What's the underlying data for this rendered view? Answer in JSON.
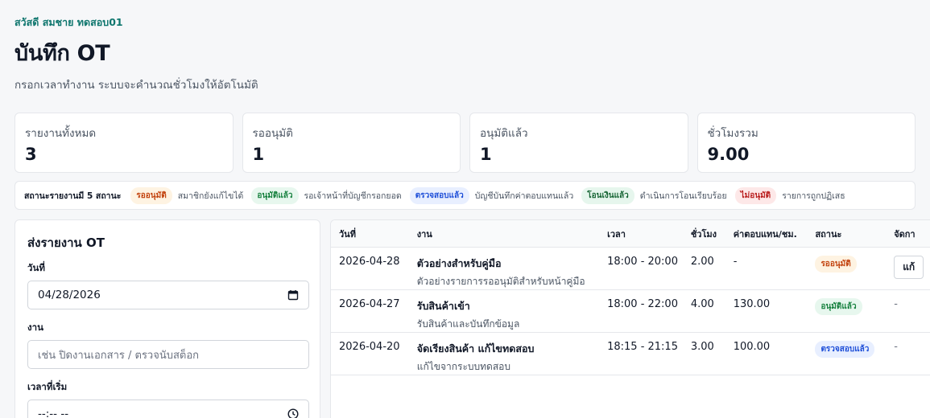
{
  "header": {
    "greeting": "สวัสดี สมชาย ทดสอบ01",
    "title": "บันทึก OT",
    "subtitle": "กรอกเวลาทำงาน ระบบจะคำนวณชั่วโมงให้อัตโนมัติ"
  },
  "stats": [
    {
      "label": "รายงานทั้งหมด",
      "value": "3"
    },
    {
      "label": "รออนุมัติ",
      "value": "1"
    },
    {
      "label": "อนุมัติแล้ว",
      "value": "1"
    },
    {
      "label": "ชั่วโมงรวม",
      "value": "9.00"
    }
  ],
  "legend": {
    "title": "สถานะรายงานมี 5 สถานะ",
    "items": [
      {
        "badge": "รออนุมัติ",
        "desc": "สมาชิกยังแก้ไขได้"
      },
      {
        "badge": "อนุมัติแล้ว",
        "desc": "รอเจ้าหน้าที่บัญชีกรอกยอด"
      },
      {
        "badge": "ตรวจสอบแล้ว",
        "desc": "บัญชีบันทึกค่าตอบแทนแล้ว"
      },
      {
        "badge": "โอนเงินแล้ว",
        "desc": "ดำเนินการโอนเรียบร้อย"
      },
      {
        "badge": "ไม่อนุมัติ",
        "desc": "รายการถูกปฏิเสธ"
      }
    ]
  },
  "form": {
    "title": "ส่งรายงาน OT",
    "date_label": "วันที่",
    "date_value": "04/28/2026",
    "task_label": "งาน",
    "task_placeholder": "เช่น ปิดงานเอกสาร / ตรวจนับสต็อก",
    "start_label": "เวลาที่เริ่ม",
    "start_value": "--:-- --"
  },
  "table": {
    "columns": [
      "วันที่",
      "งาน",
      "เวลา",
      "ชั่วโมง",
      "ค่าตอบแทน/ชม.",
      "สถานะ",
      "จัดกา"
    ],
    "rows": [
      {
        "date": "2026-04-28",
        "task": "ตัวอย่างสำหรับคู่มือ",
        "desc": "ตัวอย่างรายการรออนุมัติสำหรับหน้าคู่มือ",
        "time": "18:00 - 20:00",
        "hours": "2.00",
        "rate": "-",
        "status": "รออนุมัติ",
        "action": "แก้"
      },
      {
        "date": "2026-04-27",
        "task": "รับสินค้าเข้า",
        "desc": "รับสินค้าและบันทึกข้อมูล",
        "time": "18:00 - 22:00",
        "hours": "4.00",
        "rate": "130.00",
        "status": "อนุมัติแล้ว",
        "action": "-"
      },
      {
        "date": "2026-04-20",
        "task": "จัดเรียงสินค้า แก้ไขทดสอบ",
        "desc": "แก้ไขจากระบบทดสอบ",
        "time": "18:15 - 21:15",
        "hours": "3.00",
        "rate": "100.00",
        "status": "ตรวจสอบแล้ว",
        "action": "-"
      }
    ]
  },
  "colors": {
    "accent": "#0f766e",
    "pending": "#c2410c",
    "approved": "#15803d",
    "checked": "#1d4ed8",
    "rejected": "#b91c1c"
  },
  "icons": {
    "date_picker": "calendar-icon",
    "time_picker": "clock-icon"
  }
}
